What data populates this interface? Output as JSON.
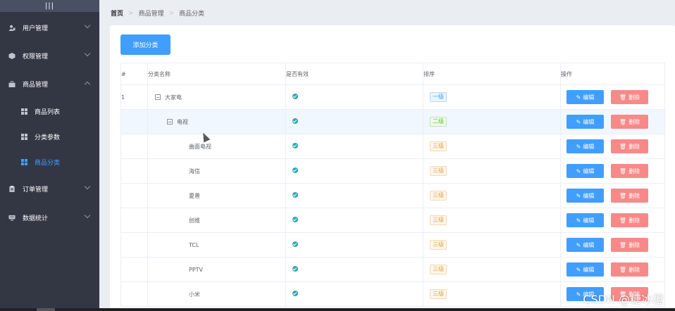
{
  "sidebar": {
    "toggle": "|||",
    "menus": [
      {
        "label": "用户管理",
        "icon": "user-icon",
        "expanded": false
      },
      {
        "label": "权限管理",
        "icon": "cube-icon",
        "expanded": false
      },
      {
        "label": "商品管理",
        "icon": "bag-icon",
        "expanded": true
      },
      {
        "label": "订单管理",
        "icon": "clipboard-icon",
        "expanded": false
      },
      {
        "label": "数据统计",
        "icon": "monitor-icon",
        "expanded": false
      }
    ],
    "sub_items": [
      {
        "label": "商品列表",
        "icon": "grid-icon",
        "active": false
      },
      {
        "label": "分类参数",
        "icon": "grid-icon",
        "active": false
      },
      {
        "label": "商品分类",
        "icon": "grid-icon",
        "active": true
      }
    ],
    "active_color": "#409eff",
    "bg_color": "#333744"
  },
  "breadcrumb": [
    "首页",
    "商品管理",
    "商品分类"
  ],
  "toolbar": {
    "add_label": "添加分类"
  },
  "table": {
    "headers": [
      "#",
      "分类名称",
      "是否有效",
      "排序",
      "操作"
    ],
    "rows": [
      {
        "index": "1",
        "name": "大家电",
        "level": "一级",
        "depth": 0,
        "expand": true
      },
      {
        "index": "",
        "name": "电视",
        "level": "二级",
        "depth": 1,
        "expand": true
      },
      {
        "index": "",
        "name": "曲面电视",
        "level": "三级",
        "depth": 2,
        "expand": false
      },
      {
        "index": "",
        "name": "海信",
        "level": "三级",
        "depth": 2,
        "expand": false
      },
      {
        "index": "",
        "name": "夏普",
        "level": "三级",
        "depth": 2,
        "expand": false
      },
      {
        "index": "",
        "name": "创维",
        "level": "三级",
        "depth": 2,
        "expand": false
      },
      {
        "index": "",
        "name": "TCL",
        "level": "三级",
        "depth": 2,
        "expand": false
      },
      {
        "index": "",
        "name": "PPTV",
        "level": "三级",
        "depth": 2,
        "expand": false
      },
      {
        "index": "",
        "name": "小米",
        "level": "三级",
        "depth": 2,
        "expand": false
      }
    ],
    "edit_label": "编辑",
    "delete_label": "删除",
    "valid_icon": "check-circle-icon"
  },
  "colors": {
    "primary": "#409eff",
    "danger": "#f78989",
    "success": "#67c23a",
    "warning": "#e6a23c"
  },
  "watermark": "CSDN @糖冰橙"
}
